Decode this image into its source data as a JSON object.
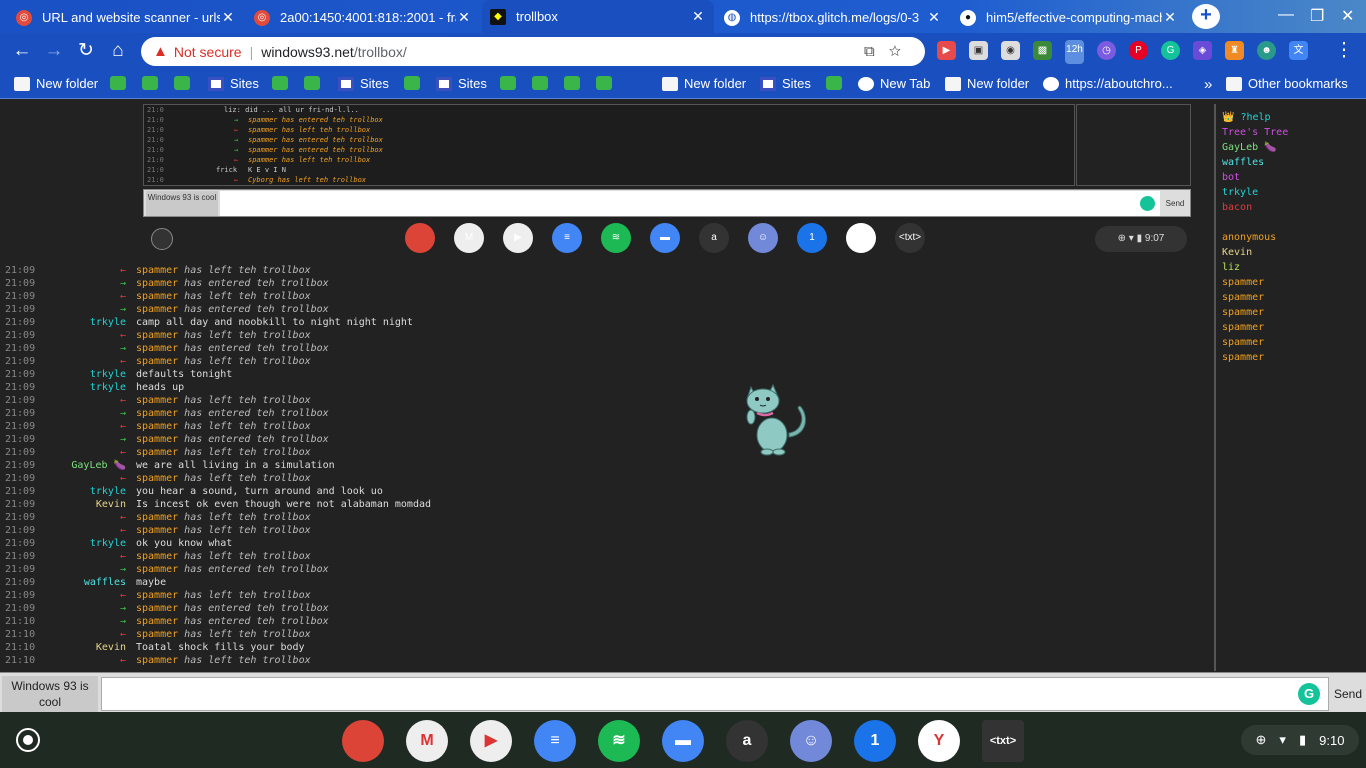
{
  "tabs": [
    {
      "title": "URL and website scanner - urlsc",
      "icon": "urlscan-icon",
      "active": false
    },
    {
      "title": "2a00:1450:4001:818::2001 - fra",
      "icon": "urlscan-icon",
      "active": false
    },
    {
      "title": "trollbox",
      "icon": "windows93-icon",
      "active": true
    },
    {
      "title": "https://tbox.glitch.me/logs/0-3",
      "icon": "globe-icon",
      "active": false
    },
    {
      "title": "him5/effective-computing-mach",
      "icon": "github-icon",
      "active": false
    }
  ],
  "omnibox": {
    "security_label": "Not secure",
    "host": "windows93.net",
    "path": "/trollbox/"
  },
  "bookmarks": [
    {
      "label": "New folder",
      "type": "folder"
    },
    {
      "label": "",
      "type": "chrome"
    },
    {
      "label": "",
      "type": "chrome"
    },
    {
      "label": "",
      "type": "chrome"
    },
    {
      "label": "Sites",
      "type": "sites"
    },
    {
      "label": "",
      "type": "chrome"
    },
    {
      "label": "",
      "type": "chrome"
    },
    {
      "label": "Sites",
      "type": "sites"
    },
    {
      "label": "",
      "type": "chrome"
    },
    {
      "label": "Sites",
      "type": "sites"
    },
    {
      "label": "",
      "type": "chrome"
    },
    {
      "label": "",
      "type": "chrome"
    },
    {
      "label": "",
      "type": "chrome"
    },
    {
      "label": "",
      "type": "chrome"
    },
    {
      "label": "New folder",
      "type": "folder"
    },
    {
      "label": "Sites",
      "type": "sites"
    },
    {
      "label": "",
      "type": "chrome"
    },
    {
      "label": "New Tab",
      "type": "globe"
    },
    {
      "label": "New folder",
      "type": "folder"
    },
    {
      "label": "https://aboutchro...",
      "type": "google"
    }
  ],
  "bookmarks_more": "»",
  "bookmarks_other": "Other bookmarks",
  "inner": {
    "rows": [
      {
        "time": "21:0",
        "nick": "",
        "msg": "liz: did ... all ur fri-nd-l.l..",
        "kind": "msg"
      },
      {
        "time": "21:0",
        "nick": "",
        "msg": "spammer has entered teh trollbox",
        "kind": "in"
      },
      {
        "time": "21:0",
        "nick": "",
        "msg": "spammer has left teh trollbox",
        "kind": "out"
      },
      {
        "time": "21:0",
        "nick": "",
        "msg": "spammer has entered teh trollbox",
        "kind": "in"
      },
      {
        "time": "21:0",
        "nick": "",
        "msg": "spammer has entered teh trollbox",
        "kind": "in"
      },
      {
        "time": "21:0",
        "nick": "",
        "msg": "spammer has left teh trollbox",
        "kind": "out"
      },
      {
        "time": "21:0",
        "nick": "frick",
        "msg": "K E v I N",
        "kind": "msg"
      },
      {
        "time": "21:0",
        "nick": "",
        "msg": "Cyborg has left teh trollbox",
        "kind": "out"
      }
    ],
    "input_label": "Windows 93 is cool",
    "send_label": "Send",
    "clock": "9:07"
  },
  "chat": [
    {
      "time": "21:09",
      "nick": "",
      "nick_color": "",
      "msg": "spammer has left teh trollbox",
      "kind": "out"
    },
    {
      "time": "21:09",
      "nick": "",
      "nick_color": "",
      "msg": "spammer has entered teh trollbox",
      "kind": "in"
    },
    {
      "time": "21:09",
      "nick": "",
      "nick_color": "",
      "msg": "spammer has left teh trollbox",
      "kind": "out"
    },
    {
      "time": "21:09",
      "nick": "",
      "nick_color": "",
      "msg": "spammer has entered teh trollbox",
      "kind": "in"
    },
    {
      "time": "21:09",
      "nick": "trkyle",
      "nick_color": "#22d3d3",
      "msg": "camp all day and noobkill to night night night",
      "kind": "msg"
    },
    {
      "time": "21:09",
      "nick": "",
      "nick_color": "",
      "msg": "spammer has left teh trollbox",
      "kind": "out"
    },
    {
      "time": "21:09",
      "nick": "",
      "nick_color": "",
      "msg": "spammer has entered teh trollbox",
      "kind": "in"
    },
    {
      "time": "21:09",
      "nick": "",
      "nick_color": "",
      "msg": "spammer has left teh trollbox",
      "kind": "out"
    },
    {
      "time": "21:09",
      "nick": "trkyle",
      "nick_color": "#22d3d3",
      "msg": "defaults tonight",
      "kind": "msg"
    },
    {
      "time": "21:09",
      "nick": "trkyle",
      "nick_color": "#22d3d3",
      "msg": "heads up",
      "kind": "msg"
    },
    {
      "time": "21:09",
      "nick": "",
      "nick_color": "",
      "msg": "spammer has left teh trollbox",
      "kind": "out"
    },
    {
      "time": "21:09",
      "nick": "",
      "nick_color": "",
      "msg": "spammer has entered teh trollbox",
      "kind": "in"
    },
    {
      "time": "21:09",
      "nick": "",
      "nick_color": "",
      "msg": "spammer has left teh trollbox",
      "kind": "out"
    },
    {
      "time": "21:09",
      "nick": "",
      "nick_color": "",
      "msg": "spammer has entered teh trollbox",
      "kind": "in"
    },
    {
      "time": "21:09",
      "nick": "",
      "nick_color": "",
      "msg": "spammer has left teh trollbox",
      "kind": "out"
    },
    {
      "time": "21:09",
      "nick": "GayLeb 🍆",
      "nick_color": "#7ee07e",
      "msg": "we are all living in a simulation",
      "kind": "msg"
    },
    {
      "time": "21:09",
      "nick": "",
      "nick_color": "",
      "msg": "spammer has left teh trollbox",
      "kind": "out"
    },
    {
      "time": "21:09",
      "nick": "trkyle",
      "nick_color": "#22d3d3",
      "msg": "you hear a sound, turn around and look uo",
      "kind": "msg"
    },
    {
      "time": "21:09",
      "nick": "Kevin",
      "nick_color": "#e8d48a",
      "msg": "Is incest ok even though were not alabaman momdad",
      "kind": "msg"
    },
    {
      "time": "21:09",
      "nick": "",
      "nick_color": "",
      "msg": "spammer has left teh trollbox",
      "kind": "out"
    },
    {
      "time": "21:09",
      "nick": "",
      "nick_color": "",
      "msg": "spammer has left teh trollbox",
      "kind": "out"
    },
    {
      "time": "21:09",
      "nick": "trkyle",
      "nick_color": "#22d3d3",
      "msg": "ok you know what",
      "kind": "msg"
    },
    {
      "time": "21:09",
      "nick": "",
      "nick_color": "",
      "msg": "spammer has left teh trollbox",
      "kind": "out"
    },
    {
      "time": "21:09",
      "nick": "",
      "nick_color": "",
      "msg": "spammer has entered teh trollbox",
      "kind": "in"
    },
    {
      "time": "21:09",
      "nick": "waffles",
      "nick_color": "#4fe3e3",
      "msg": "maybe",
      "kind": "msg"
    },
    {
      "time": "21:09",
      "nick": "",
      "nick_color": "",
      "msg": "spammer has left teh trollbox",
      "kind": "out"
    },
    {
      "time": "21:09",
      "nick": "",
      "nick_color": "",
      "msg": "spammer has entered teh trollbox",
      "kind": "in"
    },
    {
      "time": "21:10",
      "nick": "",
      "nick_color": "",
      "msg": "spammer has entered teh trollbox",
      "kind": "in"
    },
    {
      "time": "21:10",
      "nick": "",
      "nick_color": "",
      "msg": "spammer has left teh trollbox",
      "kind": "out"
    },
    {
      "time": "21:10",
      "nick": "Kevin",
      "nick_color": "#e8d48a",
      "msg": "Toatal shock fills your body",
      "kind": "msg"
    },
    {
      "time": "21:10",
      "nick": "",
      "nick_color": "",
      "msg": "spammer has left teh trollbox",
      "kind": "out"
    }
  ],
  "users": [
    {
      "name": "👑 ?help",
      "color": "#22d3d3"
    },
    {
      "name": "Tree's Tree",
      "color": "#d04fe0"
    },
    {
      "name": "GayLeb 🍆",
      "color": "#7ee07e"
    },
    {
      "name": "waffles",
      "color": "#4fe3e3"
    },
    {
      "name": "bot",
      "color": "#d04fe0"
    },
    {
      "name": "trkyle",
      "color": "#22d3d3"
    },
    {
      "name": "bacon",
      "color": "#e23b3b"
    },
    {
      "name": "",
      "color": "#222"
    },
    {
      "name": "anonymous",
      "color": "#f0a020"
    },
    {
      "name": "Kevin",
      "color": "#e8d48a"
    },
    {
      "name": "liz",
      "color": "#b6e05a"
    },
    {
      "name": "spammer",
      "color": "#f0a020"
    },
    {
      "name": "spammer",
      "color": "#f0a020"
    },
    {
      "name": "spammer",
      "color": "#f0a020"
    },
    {
      "name": "spammer",
      "color": "#f0a020"
    },
    {
      "name": "spammer",
      "color": "#f0a020"
    },
    {
      "name": "spammer",
      "color": "#f0a020"
    }
  ],
  "input": {
    "label": "Windows 93 is cool",
    "placeholder": "",
    "send_label": "Send"
  },
  "shelf": {
    "apps": [
      {
        "name": "chrome-icon",
        "glyph": "",
        "color": "#db4437"
      },
      {
        "name": "gmail-icon",
        "glyph": "M",
        "color": "#eee"
      },
      {
        "name": "play-store-icon",
        "glyph": "▶",
        "color": "#eee"
      },
      {
        "name": "google-docs-icon",
        "glyph": "≡",
        "color": "#4285f4"
      },
      {
        "name": "spotify-icon",
        "glyph": "≋",
        "color": "#1db954"
      },
      {
        "name": "files-icon",
        "glyph": "▬",
        "color": "#4285f4"
      },
      {
        "name": "avast-icon",
        "glyph": "a",
        "color": "#333"
      },
      {
        "name": "discord-icon",
        "glyph": "☺",
        "color": "#7289da"
      },
      {
        "name": "one-icon",
        "glyph": "1",
        "color": "#1a73e8"
      },
      {
        "name": "yandex-icon",
        "glyph": "Y",
        "color": "#fff"
      },
      {
        "name": "text-icon",
        "glyph": "<txt>",
        "color": "#333"
      }
    ],
    "clock": "9:10"
  }
}
